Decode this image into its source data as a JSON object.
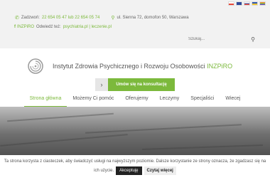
{
  "topbar": {
    "languages": [
      {
        "name": "pl",
        "color": "#e8483a"
      },
      {
        "name": "en",
        "color": "#2f4a9a"
      },
      {
        "name": "ru",
        "color": "#3058b0"
      },
      {
        "name": "ua",
        "color": "#f2c531"
      },
      {
        "name": "lgbt",
        "color": "#c54fd0"
      }
    ],
    "phone_label": "Zadzwoń:",
    "phones": "22 654 05 47 lub 22 654 05 74",
    "address": "ul. Sienna 72, domofon 50, Warszawa",
    "visit_brand": "INZPiRO",
    "visit_label": "Odwiedź też:",
    "visit_links": "psychiatria.pl | leczenie.pl",
    "search_placeholder": "Szukaj..."
  },
  "header": {
    "title": "Instytut Zdrowia Psychicznego i Rozwoju Osobowości",
    "brand": "INZPiRO"
  },
  "cta": {
    "label": "Umów się na konsultację"
  },
  "nav": {
    "items": [
      {
        "label": "Strona główna"
      },
      {
        "label": "Możemy Ci pomóc"
      },
      {
        "label": "Oferujemy"
      },
      {
        "label": "Leczymy"
      },
      {
        "label": "Specjaliści"
      },
      {
        "label": "Wiecej"
      }
    ]
  },
  "cookie": {
    "text": "Ta strona korzysta z ciasteczek, aby świadczyć usługi na najwyższym poziomie. Dalsze korzystanie ze strony oznacza, że zgadzasz się na",
    "text2": "ich użycie.",
    "accept_label": "Akceptuję",
    "more_label": "Czytaj więcej"
  },
  "colors": {
    "accent": "#7cb93c"
  }
}
